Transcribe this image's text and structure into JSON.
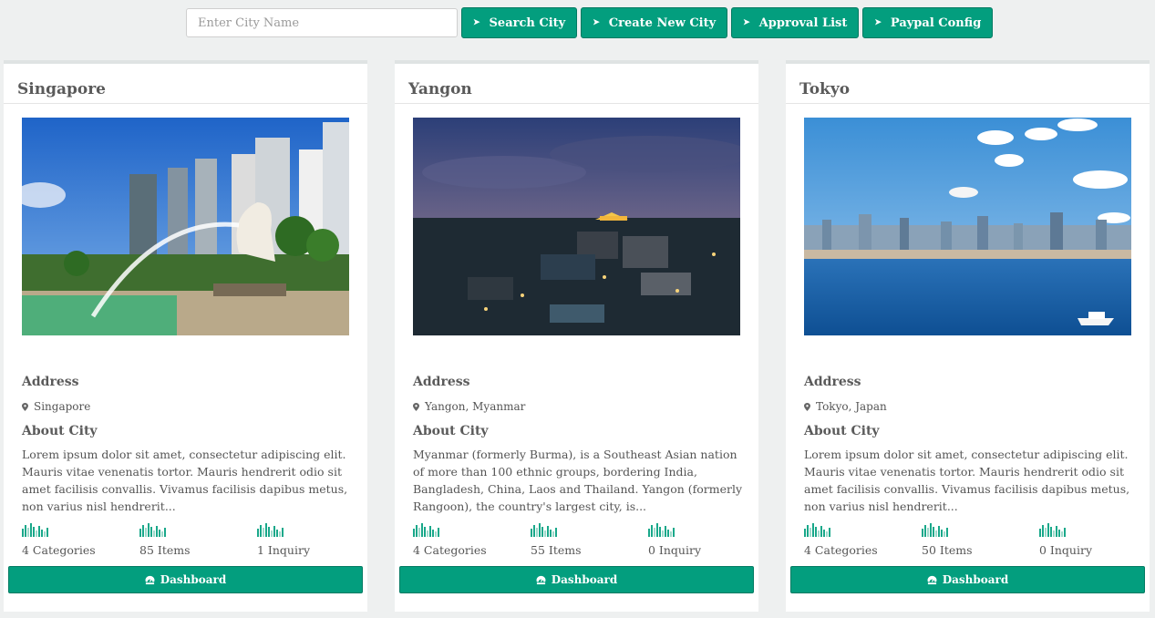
{
  "toolbar": {
    "search_placeholder": "Enter City Name",
    "search_button": "Search City",
    "create_button": "Create New City",
    "approval_button": "Approval List",
    "paypal_button": "Paypal Config"
  },
  "labels": {
    "address": "Address",
    "about": "About City",
    "dashboard": "Dashboard"
  },
  "colors": {
    "accent": "#039e7e",
    "page_bg": "#eef0f0"
  },
  "cities": [
    {
      "name": "Singapore",
      "address": "Singapore",
      "about": "Lorem ipsum dolor sit amet, consectetur adipiscing elit. Mauris vitae venenatis tortor. Mauris hendrerit odio sit amet facilisis convallis. Vivamus facilisis dapibus metus, non varius nisl hendrerit...",
      "stats": {
        "categories": "4 Categories",
        "items": "85 Items",
        "inquiry": "1 Inquiry"
      }
    },
    {
      "name": "Yangon",
      "address": "Yangon, Myanmar",
      "about": "Myanmar (formerly Burma), is a Southeast Asian nation of more than 100 ethnic groups, bordering India, Bangladesh, China, Laos and Thailand. Yangon (formerly Rangoon), the country's largest city, is...",
      "stats": {
        "categories": "4 Categories",
        "items": "55 Items",
        "inquiry": "0 Inquiry"
      }
    },
    {
      "name": "Tokyo",
      "address": "Tokyo, Japan",
      "about": "Lorem ipsum dolor sit amet, consectetur adipiscing elit. Mauris vitae venenatis tortor. Mauris hendrerit odio sit amet facilisis convallis. Vivamus facilisis dapibus metus, non varius nisl hendrerit...",
      "stats": {
        "categories": "4 Categories",
        "items": "50 Items",
        "inquiry": "0 Inquiry"
      }
    }
  ]
}
